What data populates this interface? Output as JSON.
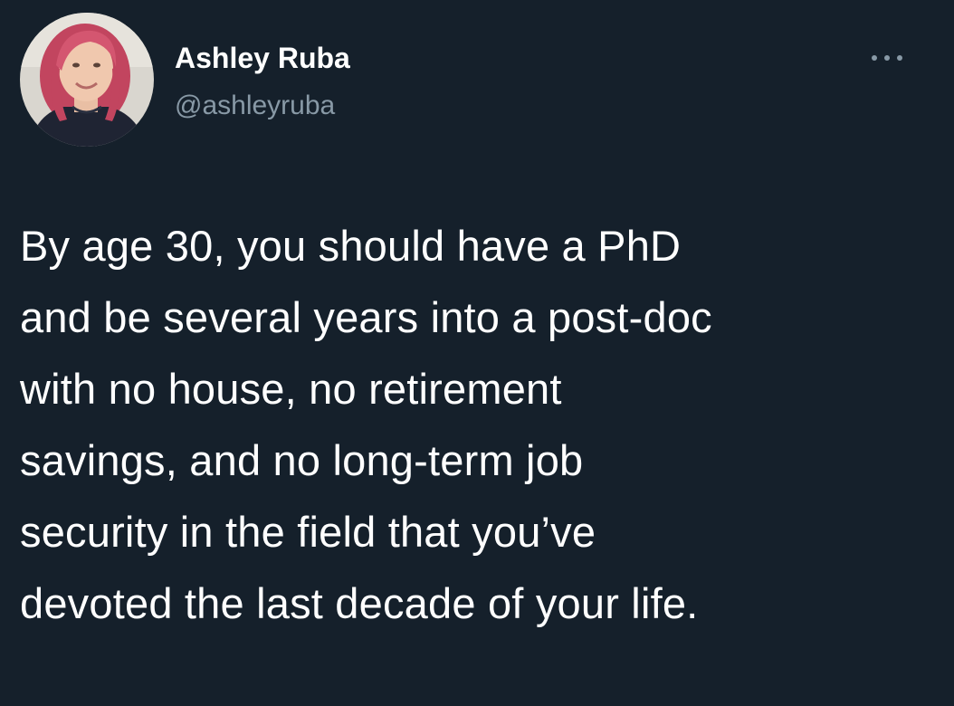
{
  "author": {
    "name": "Ashley Ruba",
    "handle": "@ashleyruba",
    "avatar_icon": "profile-photo"
  },
  "menu": {
    "icon": "more-horizontal-icon"
  },
  "tweet": {
    "lines": [
      "By age 30, you should have a PhD",
      "and be several years into a post-doc",
      "with no house, no retirement",
      "savings, and no long-term job",
      "security in the field that you’ve",
      "devoted the last decade of your life."
    ]
  },
  "colors": {
    "background": "#15202b",
    "text": "#ffffff",
    "secondary_text": "#8899a6"
  }
}
